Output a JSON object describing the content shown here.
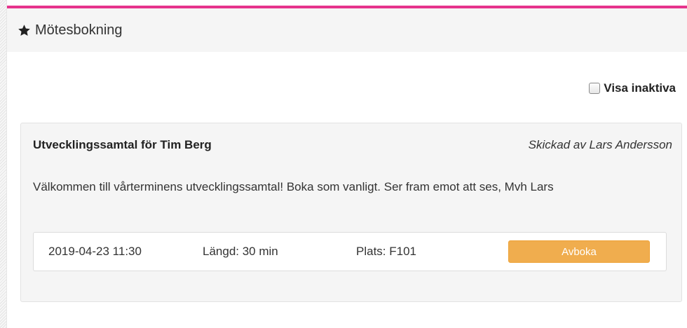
{
  "panel": {
    "title": "Mötesbokning",
    "icon": "star-icon",
    "accent_color": "#e6338c"
  },
  "filters": {
    "show_inactive_label": "Visa inaktiva",
    "show_inactive_checked": false
  },
  "invite": {
    "title": "Utvecklingssamtal för Tim Berg",
    "sender": "Skickad av Lars Andersson",
    "message": "Välkommen till vårterminens utvecklingssamtal! Boka som vanligt. Ser fram emot att ses, Mvh Lars",
    "booking": {
      "datetime": "2019-04-23 11:30",
      "length": "Längd: 30 min",
      "location": "Plats: F101",
      "cancel_label": "Avboka",
      "cancel_color": "#f0ad4e"
    }
  }
}
